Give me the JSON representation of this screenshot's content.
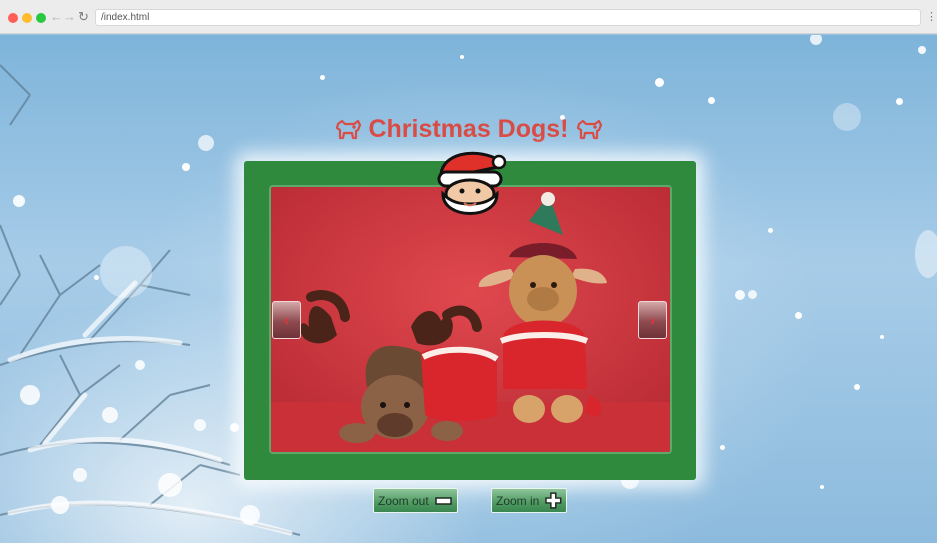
{
  "browser": {
    "url": "/index.html"
  },
  "page": {
    "title": "Christmas Dogs!",
    "zoom_out_label": "Zoom out",
    "zoom_in_label": "Zoom in",
    "prev_arrow": "‹",
    "next_arrow": "›"
  },
  "colors": {
    "title": "#d94b45",
    "frame": "#2f8a3e",
    "photo_background": "#c8333b",
    "button": "#4f9a62"
  },
  "icons": {
    "title_left": "dog-icon",
    "title_right": "dog-icon",
    "badge": "santa-icon",
    "zoom_out": "minus-icon",
    "zoom_in": "plus-icon"
  }
}
